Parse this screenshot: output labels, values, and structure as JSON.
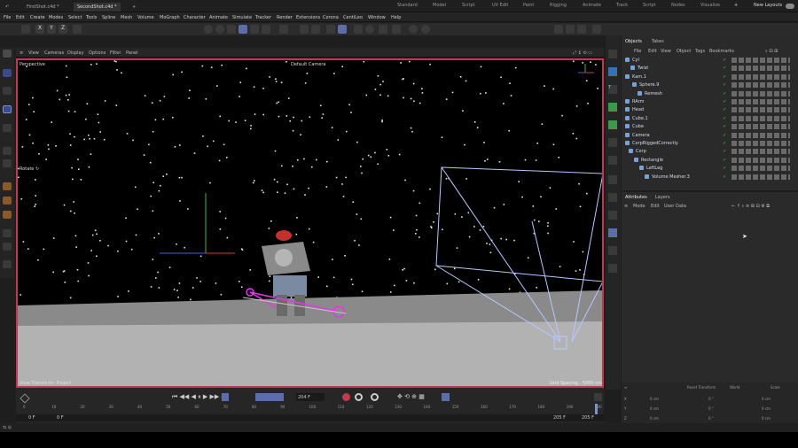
{
  "tabs": {
    "file1": "FirstShot.c4d *",
    "file2": "SecondShot.c4d *"
  },
  "layouts": [
    "Standard",
    "Model",
    "Script",
    "UV Edit",
    "Paint",
    "Rigging",
    "Animate",
    "Track",
    "Script",
    "Nodes",
    "Visualize"
  ],
  "new_layouts": "New Layouts",
  "menu": [
    "File",
    "Edit",
    "Create",
    "Modes",
    "Select",
    "Tools",
    "Spline",
    "Mesh",
    "Volume",
    "MoGraph",
    "Character",
    "Animate",
    "Simulate",
    "Tracker",
    "Render",
    "Extensions",
    "Corona",
    "CentiLeo",
    "Window",
    "Help"
  ],
  "axes": [
    "X",
    "Y",
    "Z"
  ],
  "viewport": {
    "menu": [
      "View",
      "Cameras",
      "Display",
      "Options",
      "Filter",
      "Panel"
    ],
    "perspective": "Perspective",
    "camera": "Default Camera",
    "rotate": "Rotate ↻",
    "view_transform": "View Transform: Project",
    "grid_spacing": "Grid Spacing : 5000 cm"
  },
  "objects_panel": {
    "tabs": [
      "Objects",
      "Takes"
    ],
    "menu": [
      "File",
      "Edit",
      "View",
      "Object",
      "Tags",
      "Bookmarks"
    ],
    "items": [
      "Cyl",
      "Twist",
      "Kam.1",
      "Sphere.9",
      "Remesh",
      "RArm",
      "Head",
      "Cube.1",
      "Cube",
      "Camera",
      "CorpRiggedCorrectly",
      "Corp",
      "Rectangle",
      "LeftLeg",
      "Volume Mesher.3"
    ]
  },
  "attributes_panel": {
    "tabs": [
      "Attributes",
      "Layers"
    ],
    "menu": [
      "Mode",
      "Edit",
      "User Data"
    ]
  },
  "timeline": {
    "ticks": [
      "0",
      "10",
      "20",
      "30",
      "40",
      "50",
      "60",
      "70",
      "80",
      "90",
      "100",
      "110",
      "120",
      "130",
      "140",
      "150",
      "160",
      "170",
      "180",
      "190",
      "200"
    ],
    "frame_field": "204 F",
    "start": "0 F",
    "start2": "0 F",
    "end": "205 F",
    "end2": "205 F"
  },
  "coords": {
    "rows": [
      "X",
      "Y",
      "Z"
    ],
    "pos": [
      "0 cm",
      "0 cm",
      "0 cm"
    ],
    "size": [
      "0 °",
      "0 °",
      "0 °"
    ],
    "rot": [
      "0 cm",
      "0 cm",
      "0 cm"
    ],
    "headers": [
      "Reset Transform",
      "World",
      "Scale"
    ]
  }
}
